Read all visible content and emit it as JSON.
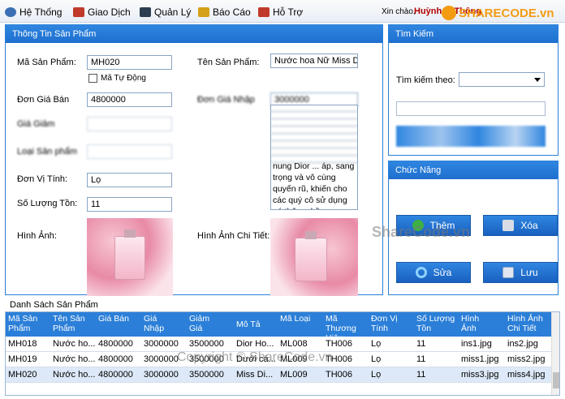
{
  "menu": [
    {
      "label": "Hệ Thống",
      "icon": "gear-icon",
      "color": "#3b6fb5"
    },
    {
      "label": "Giao Dịch",
      "icon": "transaction-icon",
      "color": "#c0392b"
    },
    {
      "label": "Quản Lý",
      "icon": "users-icon",
      "color": "#2c3e50"
    },
    {
      "label": "Báo Cáo",
      "icon": "report-icon",
      "color": "#d4a017"
    },
    {
      "label": "Hỗ Trợ",
      "icon": "help-icon",
      "color": "#c0392b"
    }
  ],
  "header": {
    "greeting": "Xin chào,",
    "user_name": "Huỳnh ... Thông"
  },
  "watermark": {
    "logo_text": "SHARECODE.vn",
    "mid_text": "ShareCode.vn",
    "copyright": "Copyright © ShareCode.vn"
  },
  "product_info": {
    "title": "Thông Tin Sản Phẩm",
    "ma_sp_label": "Mã Sản Phẩm:",
    "ma_sp_value": "MH020",
    "auto_code_label": "Mã Tự Động",
    "ten_sp_label": "Tên Sản Phẩm:",
    "ten_sp_value": "Nước hoa Nữ Miss Di",
    "don_gia_ban_label": "Đơn Giá Bán",
    "don_gia_ban_value": "4800000",
    "don_gia_nhap_label": "Đơn Giá Nhập",
    "don_gia_nhap_value": "3000000",
    "gia_giam_label": "Giá Giảm",
    "loai_sp_label": "Loại Sản phẩm",
    "mo_ta_value": "nung Dior ... áp, sang trọng và vô cùng quyến rũ, khiến cho các quý cô sử dụng nó thêm phần",
    "don_vi_tinh_label": "Đơn Vị Tính:",
    "don_vi_tinh_value": "Lọ",
    "so_luong_ton_label": "Số Lượng Tồn:",
    "so_luong_ton_value": "11",
    "hinh_anh_label": "Hình Ảnh:",
    "hinh_anh_ct_label": "Hình Ảnh Chi Tiết:"
  },
  "search": {
    "title": "Tìm Kiếm",
    "by_label": "Tìm kiếm theo:"
  },
  "functions": {
    "title": "Chức Năng",
    "add": "Thêm",
    "delete": "Xóa",
    "edit": "Sửa",
    "save": "Lưu"
  },
  "list": {
    "title": "Danh Sách Sản Phẩm",
    "columns": [
      "Mã Sản Phẩm",
      "Tên Sản Phẩm",
      "Giá Bán",
      "Giá Nhập",
      "Giảm Giá",
      "Mô Tả",
      "Mã Loại",
      "Mã Thương Hiệu",
      "Đơn Vị Tính",
      "Số Lượng Tồn",
      "Hình Ảnh",
      "Hình Ảnh Chi Tiết"
    ],
    "rows": [
      [
        "MH018",
        "Nước ho...",
        "4800000",
        "3000000",
        "3500000",
        "Dior Ho...",
        "ML008",
        "TH006",
        "Lọ",
        "11",
        "ins1.jpg",
        "ins2.jpg"
      ],
      [
        "MH019",
        "Nước ho...",
        "4800000",
        "3000000",
        "3500000",
        "Dưới cá...",
        "ML009",
        "TH006",
        "Lọ",
        "11",
        "miss1.jpg",
        "miss2.jpg"
      ],
      [
        "MH020",
        "Nước ho...",
        "4800000",
        "3000000",
        "3500000",
        "Miss Di...",
        "ML009",
        "TH006",
        "Lọ",
        "11",
        "miss3.jpg",
        "miss4.jpg"
      ]
    ]
  }
}
